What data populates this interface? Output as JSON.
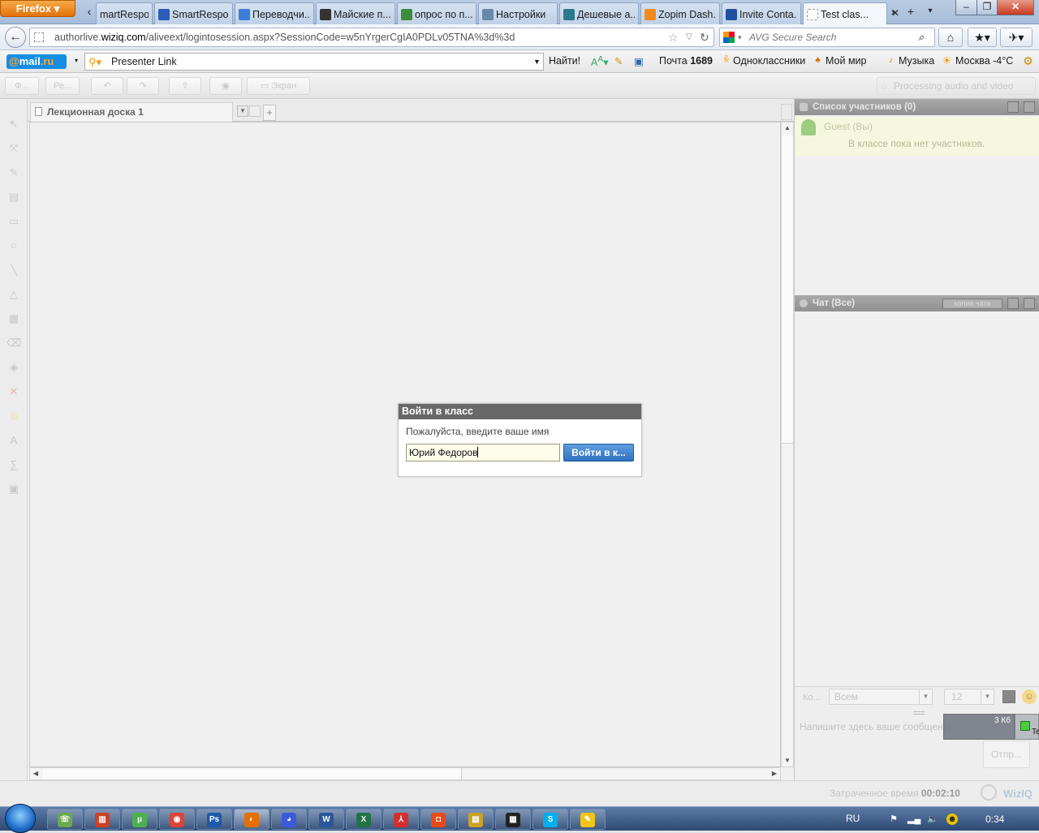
{
  "browser": {
    "firefox_label": "Firefox",
    "tabs": [
      {
        "label": "martRespo...",
        "icon": "page-icon",
        "color": "#4a6fa5"
      },
      {
        "label": "SmartRespo...",
        "icon": "smartresponse-icon",
        "color": "#2a5cb8"
      },
      {
        "label": "Переводчи...",
        "icon": "translate-icon",
        "color": "#3b7dd8"
      },
      {
        "label": "Майские п...",
        "icon": "diamond-icon",
        "color": "#333333"
      },
      {
        "label": "опрос по п...",
        "icon": "google-icon",
        "color": "#3c8c3c"
      },
      {
        "label": "Настройки",
        "icon": "search-icon",
        "color": "#6688aa"
      },
      {
        "label": "Дешевые а...",
        "icon": "wave-icon",
        "color": "#2a7a8a"
      },
      {
        "label": "Zopim Dash...",
        "icon": "zopim-icon",
        "color": "#f28a1c"
      },
      {
        "label": "Invite Conta...",
        "icon": "word-icon",
        "color": "#1e4fa0"
      },
      {
        "label": "Test clas...",
        "icon": "blank-page-icon",
        "color": "#ffffff",
        "active": true
      }
    ],
    "url_host": "authorlive.",
    "url_domain": "wiziq.com",
    "url_path": "/aliveext/logintosession.aspx?SessionCode=w5nYrgerCgIA0PDLv05TNA%3d%3d",
    "search_placeholder": "AVG Secure Search"
  },
  "mail_toolbar": {
    "logo_at": "@",
    "logo_mail": "mail",
    "logo_ru": ".ru",
    "presenter_link": "Presenter Link",
    "find": "Найти!",
    "mail_label": "Почта",
    "mail_count": "1689",
    "odnoklassniki": "Одноклассники",
    "moi_mir": "Мой мир",
    "music": "Музыка",
    "weather": "Москва -4°C"
  },
  "app": {
    "toolbar": {
      "btn1": "Ф...",
      "btn2": "Ре...",
      "screen": "Экран",
      "processing": "Processing audio and video"
    },
    "board_tab": "Лекционная доска 1",
    "participants_title": "Список участников (0)",
    "guest": "Guest (Вы)",
    "no_participants": "В классе пока нет участников.",
    "chat_title": "Чат (Все)",
    "chat_copy": "копия чата",
    "to_label": "Ко...",
    "to_value": "Всем",
    "font_size": "12",
    "chat_placeholder": "Напишите здесь ваше сообщение",
    "send": "Отпр...",
    "elapsed_label": "Затраченное время",
    "elapsed_value": "00:02:10",
    "wiziq": "WizIQ"
  },
  "dialog": {
    "title": "Войти в класс",
    "prompt": "Пожалуйста, введите ваше имя",
    "name_value": "Юрий Федоров",
    "button": "Войти в к..."
  },
  "notification": {
    "size": "3 Кб",
    "label": "Te"
  },
  "taskbar": {
    "lang": "RU",
    "time": "0:34"
  }
}
